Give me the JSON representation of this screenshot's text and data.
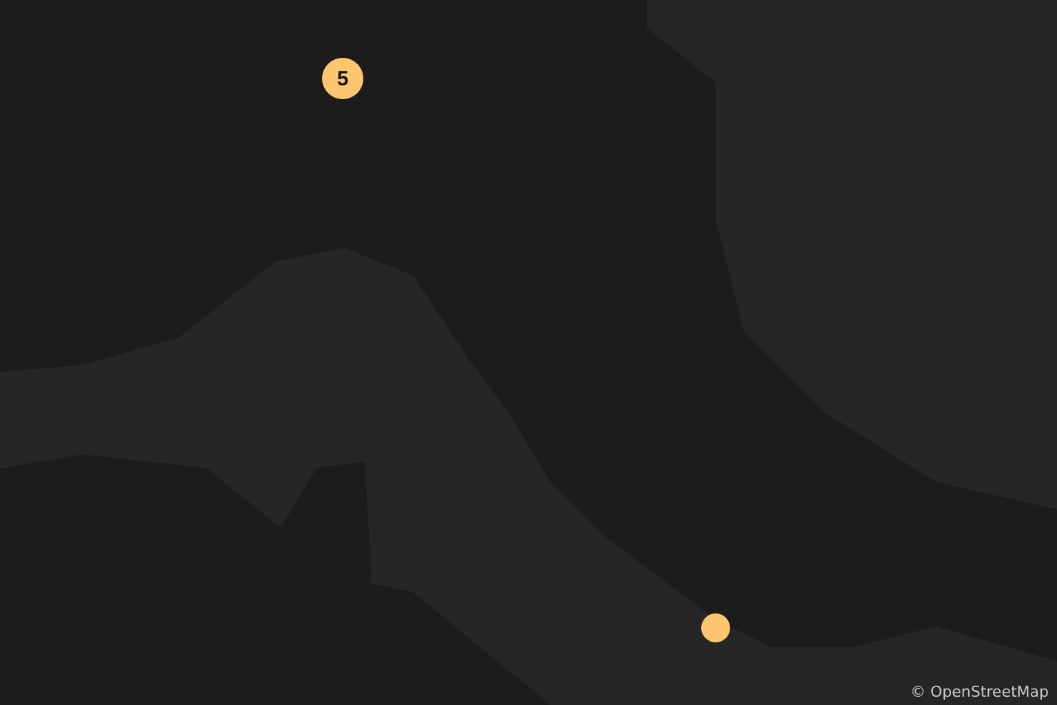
{
  "map": {
    "markers": [
      {
        "kind": "cluster",
        "count": "5"
      },
      {
        "kind": "point"
      }
    ],
    "attribution": "© OpenStreetMap"
  }
}
